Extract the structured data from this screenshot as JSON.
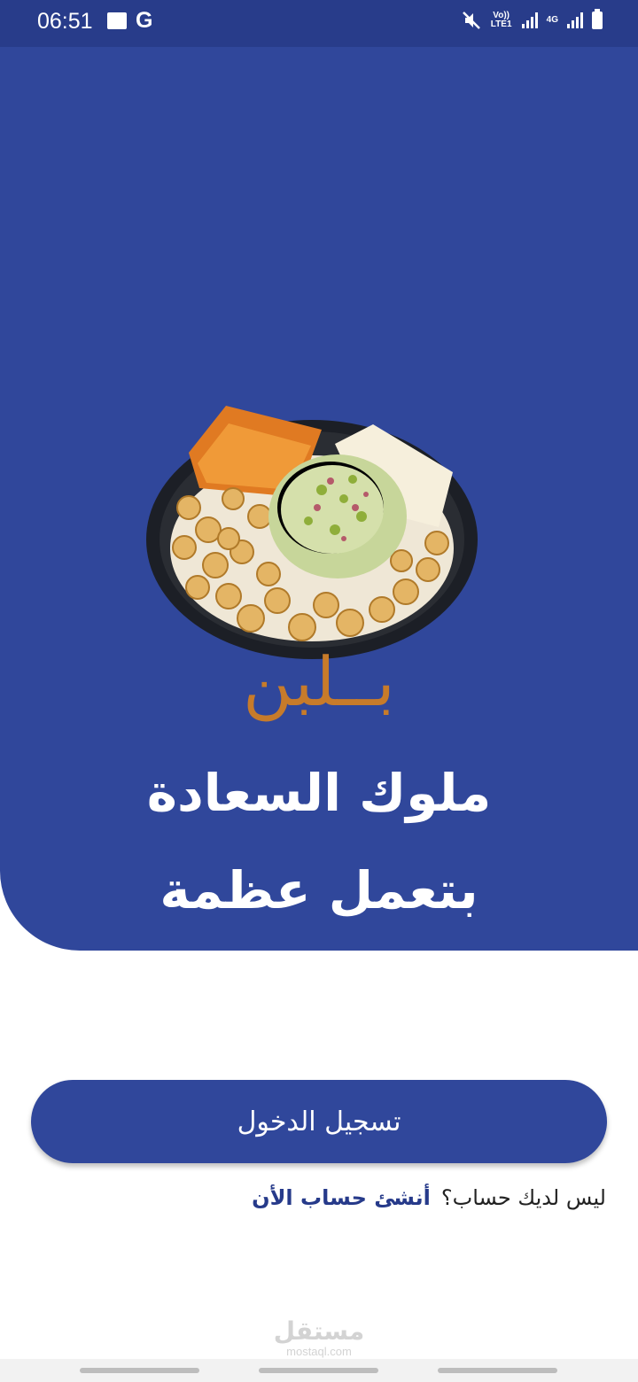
{
  "status_bar": {
    "time": "06:51",
    "g_letter": "G",
    "volte_label": "Vo)) LTE1",
    "network_label": "4G",
    "icons": [
      "gallery-icon",
      "google-icon",
      "mute-icon",
      "signal-icon",
      "battery-icon"
    ]
  },
  "hero": {
    "brand_name": "بــلبن",
    "tagline_line1": "ملوك السعادة",
    "tagline_line2": "بتعمل عظمة",
    "colors": {
      "background": "#30479b",
      "brand": "#c77b2a"
    }
  },
  "auth": {
    "login_label": "تسجيل الدخول",
    "signup_prompt": "ليس لديك حساب؟",
    "signup_link": "أنشئ حساب الأن"
  },
  "watermark": {
    "name": "مستقل",
    "domain": "mostaql.com"
  }
}
